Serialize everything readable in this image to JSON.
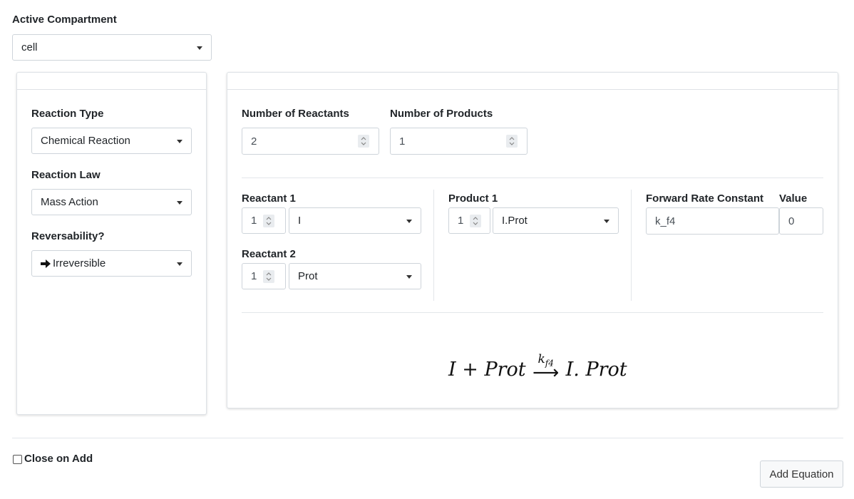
{
  "compartment": {
    "label": "Active Compartment",
    "value": "cell"
  },
  "left_panel": {
    "reaction_type_label": "Reaction Type",
    "reaction_type_value": "Chemical Reaction",
    "reaction_law_label": "Reaction Law",
    "reaction_law_value": "Mass Action",
    "reversibility_label": "Reversability?",
    "reversibility_value": "Irreversible",
    "reversibility_icon": "right-arrow-icon"
  },
  "main_panel": {
    "num_reactants_label": "Number of Reactants",
    "num_reactants_value": "2",
    "num_products_label": "Number of Products",
    "num_products_value": "1",
    "reactants": [
      {
        "label": "Reactant 1",
        "coef": "1",
        "species": "I"
      },
      {
        "label": "Reactant 2",
        "coef": "1",
        "species": "Prot"
      }
    ],
    "products": [
      {
        "label": "Product 1",
        "coef": "1",
        "species": "I.Prot"
      }
    ],
    "rate_constant_label": "Forward Rate Constant",
    "rate_constant_value": "k_f4",
    "value_label": "Value",
    "value_value": "0",
    "equation": {
      "lhs": "I + Prot",
      "arrow": "⟶",
      "rate_base": "k",
      "rate_sub": "f4",
      "rhs": "I. Prot"
    }
  },
  "footer": {
    "close_on_add_label": "Close on Add",
    "close_on_add_checked": false,
    "add_button_label": "Add Equation"
  }
}
